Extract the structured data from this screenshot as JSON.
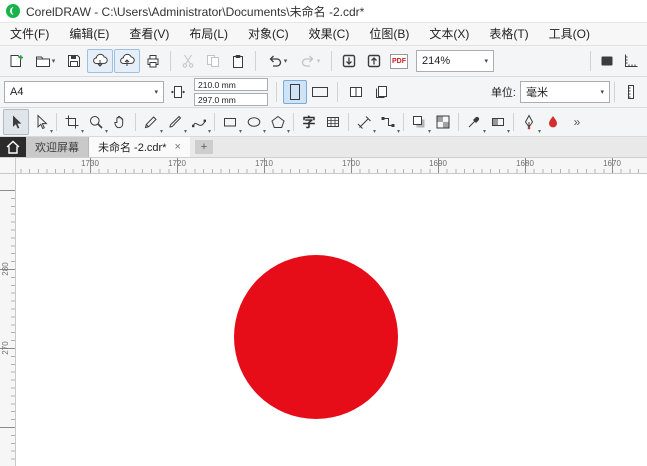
{
  "window": {
    "title": "CorelDRAW - C:\\Users\\Administrator\\Documents\\未命名 -2.cdr*"
  },
  "menubar": {
    "items": [
      "文件(F)",
      "编辑(E)",
      "查看(V)",
      "布局(L)",
      "对象(C)",
      "效果(C)",
      "位图(B)",
      "文本(X)",
      "表格(T)",
      "工具(O)"
    ]
  },
  "standard_toolbar": {
    "zoom_value": "214%",
    "pdf_label": "PDF"
  },
  "property_bar": {
    "page_size": "A4",
    "width": "210.0 mm",
    "height": "297.0 mm",
    "units_label": "单位:",
    "units": "毫米"
  },
  "toolbox": {
    "text_glyph": "字",
    "tools": [
      "pick",
      "freehand-pick",
      "crop",
      "zoom",
      "pan",
      "freehand",
      "artistic-media",
      "b-spline",
      "rectangle",
      "ellipse",
      "polygon",
      "text",
      "table",
      "parallel-dimension",
      "connector",
      "drop-shadow",
      "transparency",
      "color-eyedropper",
      "interactive-fill",
      "outline-pen",
      "fill-color",
      "more"
    ]
  },
  "tabs": {
    "welcome": "欢迎屏幕",
    "document": "未命名 -2.cdr*",
    "close_glyph": "×",
    "new_tab": "+"
  },
  "rulers": {
    "horizontal": [
      "1730",
      "1720",
      "1710",
      "1700",
      "1690",
      "1680",
      "1670"
    ],
    "vertical": [
      "280",
      "270"
    ]
  },
  "canvas": {
    "circle_fill": "#e60c18"
  },
  "icons": {
    "caret": "▾",
    "more": "»"
  }
}
